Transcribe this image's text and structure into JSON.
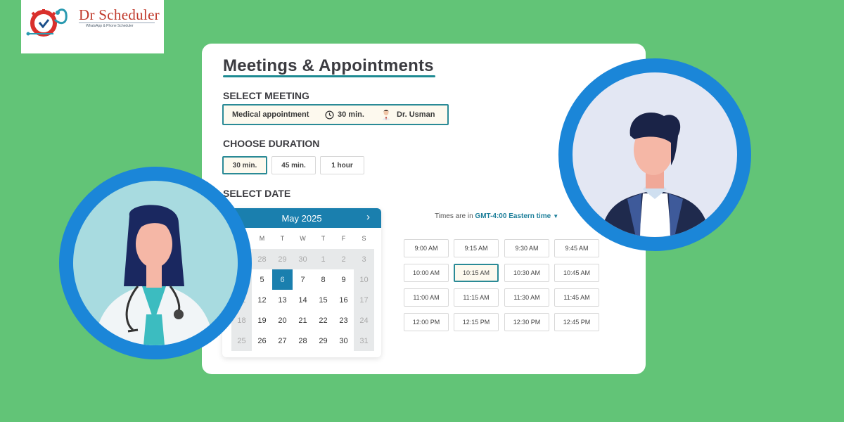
{
  "logo": {
    "title": "Dr Scheduler",
    "subtitle": "WhatsApp & Phone Scheduler"
  },
  "card": {
    "title": "Meetings & Appointments",
    "select_meeting_label": "SELECT MEETING",
    "meeting": {
      "name": "Medical appointment",
      "duration": "30 min.",
      "doctor": "Dr. Usman"
    },
    "choose_duration_label": "CHOOSE DURATION",
    "durations": [
      {
        "label": "30 min.",
        "selected": true
      },
      {
        "label": "45 min.",
        "selected": false
      },
      {
        "label": "1 hour",
        "selected": false
      }
    ],
    "select_date_label": "SELECT DATE"
  },
  "calendar": {
    "month_label": "May 2025",
    "prev_icon": "chevron-left",
    "next_icon": "chevron-right",
    "weekdays": [
      "M",
      "T",
      "W",
      "T",
      "F",
      "S"
    ],
    "weeks": [
      [
        "28",
        "29",
        "30",
        "1",
        "2",
        "3"
      ],
      [
        "5",
        "6",
        "7",
        "8",
        "9",
        "10"
      ],
      [
        "12",
        "13",
        "14",
        "15",
        "16",
        "17"
      ],
      [
        "19",
        "20",
        "21",
        "22",
        "23",
        "24"
      ],
      [
        "26",
        "27",
        "28",
        "29",
        "30",
        "31"
      ]
    ],
    "hidden_first_column": [
      "",
      "",
      "11",
      "18",
      "25"
    ],
    "selected_day": "6"
  },
  "times": {
    "prefix": "Times are in ",
    "timezone": "GMT-4:00 Eastern time",
    "slots": [
      "9:00 AM",
      "9:15 AM",
      "9:30 AM",
      "9:45 AM",
      "10:00 AM",
      "10:15 AM",
      "10:30 AM",
      "10:45 AM",
      "11:00 AM",
      "11:15 AM",
      "11:30 AM",
      "11:45 AM",
      "12:00 PM",
      "12:15 PM",
      "12:30 PM",
      "12:45 PM"
    ],
    "selected_slot": "10:15 AM"
  },
  "colors": {
    "background": "#62c477",
    "accent_teal": "#2a8a96",
    "calendar_blue": "#1a7fae",
    "avatar_ring": "#1b86d8"
  }
}
